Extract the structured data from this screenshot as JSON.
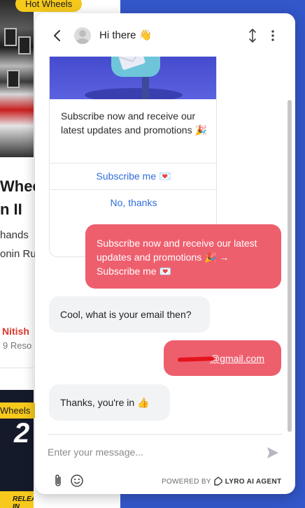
{
  "background_page": {
    "top_tag": "Hot Wheels",
    "title_line1": "Whee",
    "title_line2": "n II",
    "line1": "hands",
    "line2": "onin Ru",
    "author": "Nitish",
    "resources": "9 Reso",
    "bottom_tag": "Wheels",
    "bottom_strip": "RELEASED IN",
    "bottom_numeral": "2"
  },
  "chat": {
    "header": {
      "title": "Hi there",
      "title_emoji": "👋"
    },
    "card": {
      "text": "Subscribe now and receive our latest updates and promotions 🎉",
      "subscribe_button": "Subscribe me 💌",
      "decline_button": "No, thanks"
    },
    "messages": [
      {
        "sender": "user",
        "text": "Subscribe now and receive our latest updates and promotions 🎉 → Subscribe me 💌"
      },
      {
        "sender": "bot",
        "text": "Cool, what is your email then?"
      },
      {
        "sender": "user",
        "text": "@gmail.com",
        "redacted_prefix": true
      },
      {
        "sender": "bot",
        "text": "Thanks, you're in 👍"
      }
    ],
    "composer": {
      "placeholder": "Enter your message...",
      "powered_by": "POWERED BY",
      "brand": "LYRO AI AGENT"
    },
    "colors": {
      "user_bubble": "#ee5f6e",
      "bot_bubble": "#f2f3f5",
      "link": "#2f6ddb",
      "page_background": "#3357c9"
    }
  }
}
